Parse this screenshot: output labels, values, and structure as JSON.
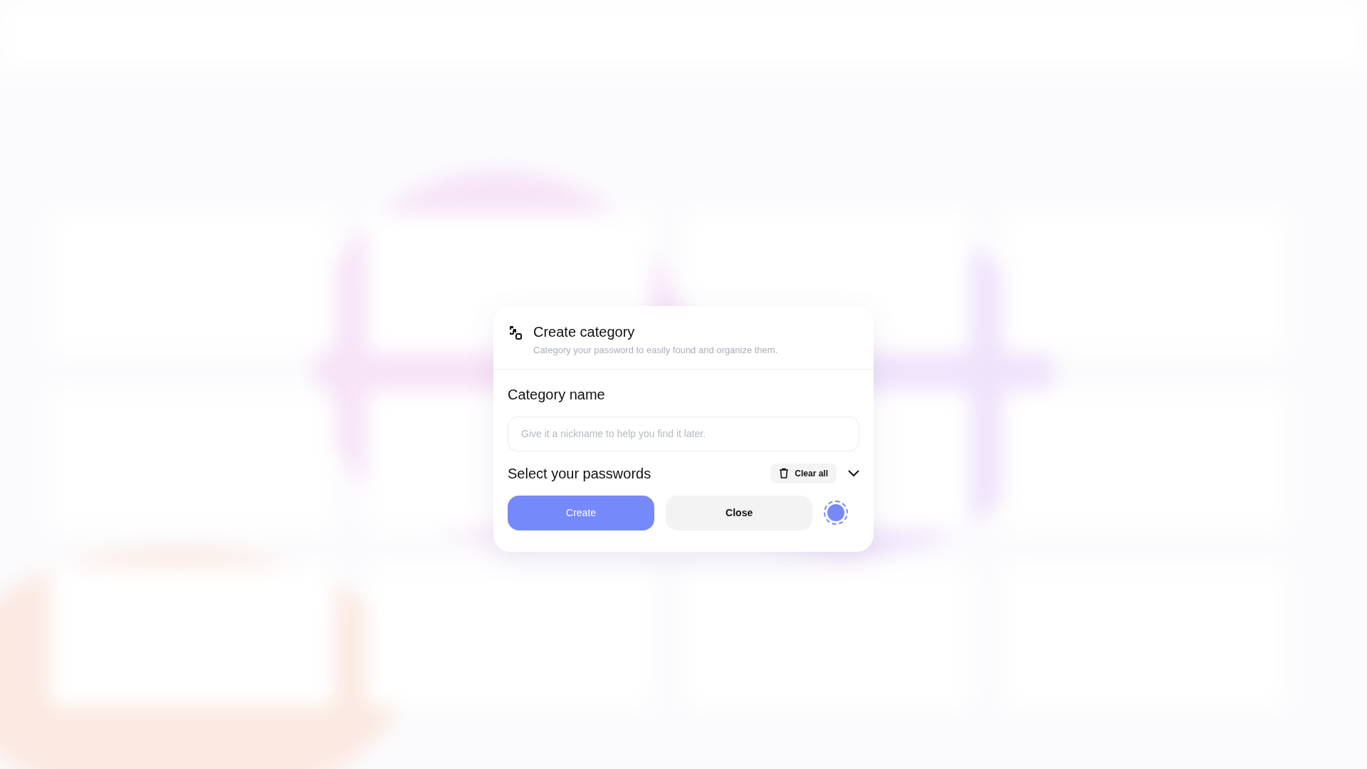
{
  "dialog": {
    "title": "Create category",
    "subtitle": "Category your password to easily found and organize them.",
    "name_field": {
      "label": "Category name",
      "placeholder": "Give it a nickname to help you find it later."
    },
    "passwords": {
      "label": "Select your passwords",
      "clear_button": "Clear all",
      "expanded": false
    },
    "buttons": [
      {
        "kind": "primary",
        "label": "Create"
      },
      {
        "kind": "secondary",
        "label": "Close"
      }
    ],
    "color_picker": {
      "color": "#7589fb"
    }
  }
}
